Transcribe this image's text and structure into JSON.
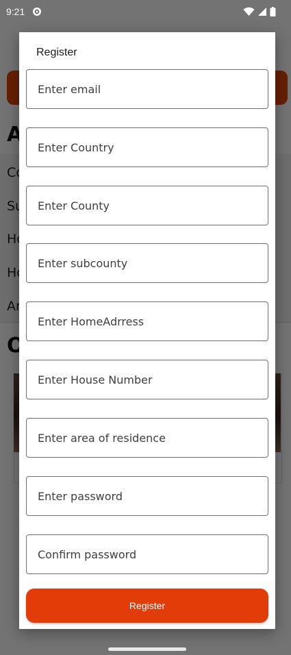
{
  "status_bar": {
    "time": "9:21",
    "icons": [
      "sync-icon",
      "wifi-icon",
      "signal-icon",
      "battery-icon"
    ]
  },
  "background": {
    "heading_1": "A",
    "heading_2": "O",
    "rows": [
      "Co",
      "Su",
      "Ho",
      "Ho",
      "Ar"
    ],
    "accent_color": "#e4470b"
  },
  "dialog": {
    "title": "Register",
    "fields": {
      "email": {
        "placeholder": "Enter email",
        "value": ""
      },
      "country": {
        "placeholder": "Enter Country",
        "value": ""
      },
      "county": {
        "placeholder": "Enter County",
        "value": ""
      },
      "subcounty": {
        "placeholder": "Enter subcounty",
        "value": ""
      },
      "home_address": {
        "placeholder": "Enter HomeAdrress",
        "value": ""
      },
      "house_number": {
        "placeholder": "Enter House Number",
        "value": ""
      },
      "area_of_residence": {
        "placeholder": "Enter area of residence",
        "value": ""
      },
      "password": {
        "placeholder": "Enter password",
        "value": ""
      },
      "confirm_password": {
        "placeholder": "Confirm password",
        "value": ""
      }
    },
    "register_button": {
      "label": "Register",
      "color": "#e23c09"
    }
  }
}
